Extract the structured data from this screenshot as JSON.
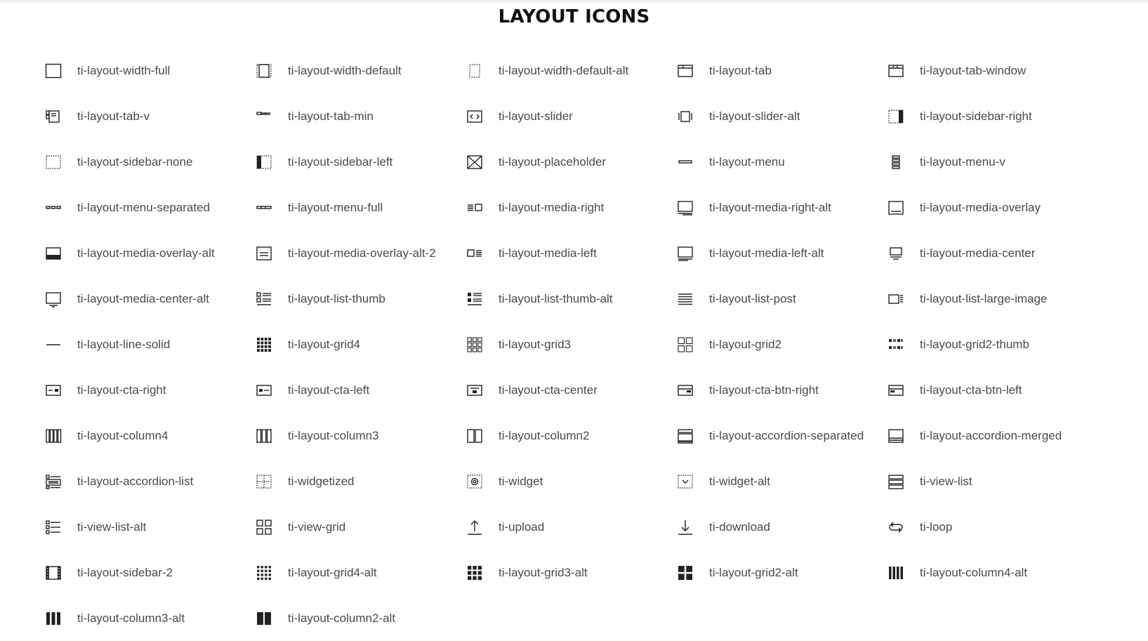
{
  "page": {
    "title": "LAYOUT ICONS"
  },
  "icons": [
    {
      "label": "ti-layout-width-full",
      "icon": "layout-width-full-icon"
    },
    {
      "label": "ti-layout-width-default",
      "icon": "layout-width-default-icon"
    },
    {
      "label": "ti-layout-width-default-alt",
      "icon": "layout-width-default-alt-icon"
    },
    {
      "label": "ti-layout-tab",
      "icon": "layout-tab-icon"
    },
    {
      "label": "ti-layout-tab-window",
      "icon": "layout-tab-window-icon"
    },
    {
      "label": "ti-layout-tab-v",
      "icon": "layout-tab-v-icon"
    },
    {
      "label": "ti-layout-tab-min",
      "icon": "layout-tab-min-icon"
    },
    {
      "label": "ti-layout-slider",
      "icon": "layout-slider-icon"
    },
    {
      "label": "ti-layout-slider-alt",
      "icon": "layout-slider-alt-icon"
    },
    {
      "label": "ti-layout-sidebar-right",
      "icon": "layout-sidebar-right-icon"
    },
    {
      "label": "ti-layout-sidebar-none",
      "icon": "layout-sidebar-none-icon"
    },
    {
      "label": "ti-layout-sidebar-left",
      "icon": "layout-sidebar-left-icon"
    },
    {
      "label": "ti-layout-placeholder",
      "icon": "layout-placeholder-icon"
    },
    {
      "label": "ti-layout-menu",
      "icon": "layout-menu-icon"
    },
    {
      "label": "ti-layout-menu-v",
      "icon": "layout-menu-v-icon"
    },
    {
      "label": "ti-layout-menu-separated",
      "icon": "layout-menu-separated-icon"
    },
    {
      "label": "ti-layout-menu-full",
      "icon": "layout-menu-full-icon"
    },
    {
      "label": "ti-layout-media-right",
      "icon": "layout-media-right-icon"
    },
    {
      "label": "ti-layout-media-right-alt",
      "icon": "layout-media-right-alt-icon"
    },
    {
      "label": "ti-layout-media-overlay",
      "icon": "layout-media-overlay-icon"
    },
    {
      "label": "ti-layout-media-overlay-alt",
      "icon": "layout-media-overlay-alt-icon"
    },
    {
      "label": "ti-layout-media-overlay-alt-2",
      "icon": "layout-media-overlay-alt-2-icon"
    },
    {
      "label": "ti-layout-media-left",
      "icon": "layout-media-left-icon"
    },
    {
      "label": "ti-layout-media-left-alt",
      "icon": "layout-media-left-alt-icon"
    },
    {
      "label": "ti-layout-media-center",
      "icon": "layout-media-center-icon"
    },
    {
      "label": "ti-layout-media-center-alt",
      "icon": "layout-media-center-alt-icon"
    },
    {
      "label": "ti-layout-list-thumb",
      "icon": "layout-list-thumb-icon"
    },
    {
      "label": "ti-layout-list-thumb-alt",
      "icon": "layout-list-thumb-alt-icon"
    },
    {
      "label": "ti-layout-list-post",
      "icon": "layout-list-post-icon"
    },
    {
      "label": "ti-layout-list-large-image",
      "icon": "layout-list-large-image-icon"
    },
    {
      "label": "ti-layout-line-solid",
      "icon": "layout-line-solid-icon"
    },
    {
      "label": "ti-layout-grid4",
      "icon": "layout-grid4-icon"
    },
    {
      "label": "ti-layout-grid3",
      "icon": "layout-grid3-icon"
    },
    {
      "label": "ti-layout-grid2",
      "icon": "layout-grid2-icon"
    },
    {
      "label": "ti-layout-grid2-thumb",
      "icon": "layout-grid2-thumb-icon"
    },
    {
      "label": "ti-layout-cta-right",
      "icon": "layout-cta-right-icon"
    },
    {
      "label": "ti-layout-cta-left",
      "icon": "layout-cta-left-icon"
    },
    {
      "label": "ti-layout-cta-center",
      "icon": "layout-cta-center-icon"
    },
    {
      "label": "ti-layout-cta-btn-right",
      "icon": "layout-cta-btn-right-icon"
    },
    {
      "label": "ti-layout-cta-btn-left",
      "icon": "layout-cta-btn-left-icon"
    },
    {
      "label": "ti-layout-column4",
      "icon": "layout-column4-icon"
    },
    {
      "label": "ti-layout-column3",
      "icon": "layout-column3-icon"
    },
    {
      "label": "ti-layout-column2",
      "icon": "layout-column2-icon"
    },
    {
      "label": "ti-layout-accordion-separated",
      "icon": "layout-accordion-separated-icon"
    },
    {
      "label": "ti-layout-accordion-merged",
      "icon": "layout-accordion-merged-icon"
    },
    {
      "label": "ti-layout-accordion-list",
      "icon": "layout-accordion-list-icon"
    },
    {
      "label": "ti-widgetized",
      "icon": "widgetized-icon"
    },
    {
      "label": "ti-widget",
      "icon": "widget-icon"
    },
    {
      "label": "ti-widget-alt",
      "icon": "widget-alt-icon"
    },
    {
      "label": "ti-view-list",
      "icon": "view-list-icon"
    },
    {
      "label": "ti-view-list-alt",
      "icon": "view-list-alt-icon"
    },
    {
      "label": "ti-view-grid",
      "icon": "view-grid-icon"
    },
    {
      "label": "ti-upload",
      "icon": "upload-icon"
    },
    {
      "label": "ti-download",
      "icon": "download-icon"
    },
    {
      "label": "ti-loop",
      "icon": "loop-icon"
    },
    {
      "label": "ti-layout-sidebar-2",
      "icon": "layout-sidebar-2-icon"
    },
    {
      "label": "ti-layout-grid4-alt",
      "icon": "layout-grid4-alt-icon"
    },
    {
      "label": "ti-layout-grid3-alt",
      "icon": "layout-grid3-alt-icon"
    },
    {
      "label": "ti-layout-grid2-alt",
      "icon": "layout-grid2-alt-icon"
    },
    {
      "label": "ti-layout-column4-alt",
      "icon": "layout-column4-alt-icon"
    },
    {
      "label": "ti-layout-column3-alt",
      "icon": "layout-column3-alt-icon"
    },
    {
      "label": "ti-layout-column2-alt",
      "icon": "layout-column2-alt-icon"
    }
  ],
  "colors": {
    "icon": "#222222",
    "text": "#4a4a4a",
    "title": "#111111"
  }
}
